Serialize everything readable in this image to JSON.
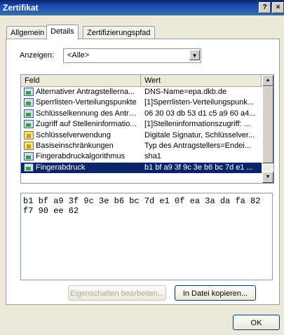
{
  "window": {
    "title": "Zertifikat",
    "help_label": "?",
    "close_label": "×"
  },
  "tabs": [
    {
      "label": "Allgemein"
    },
    {
      "label": "Details"
    },
    {
      "label": "Zertifizierungspfad"
    }
  ],
  "show": {
    "label": "Anzeigen:",
    "selected": "<Alle>"
  },
  "list": {
    "columns": {
      "field": "Feld",
      "value": "Wert"
    },
    "rows": [
      {
        "field": "Alternativer Antragstellerna...",
        "value": "DNS-Name=epa.dkb.de",
        "icon": "certificate-field-icon"
      },
      {
        "field": "Sperrlisten-Verteilungspunkte",
        "value": "[1]Sperrlisten-Verteilungspunk...",
        "icon": "certificate-field-icon"
      },
      {
        "field": "Schlüsselkennung des Antra...",
        "value": "06 30 03 db 53 d1 c5 a9 60 a4...",
        "icon": "certificate-field-icon"
      },
      {
        "field": "Zugriff auf Stelleninformatio...",
        "value": "[1]Stelleninformationszugriff: ...",
        "icon": "certificate-field-icon"
      },
      {
        "field": "Schlüsselverwendung",
        "value": "Digitale Signatur, Schlüsselver...",
        "icon": "critical-extension-icon"
      },
      {
        "field": "Basiseinschränkungen",
        "value": "Typ des Antragstellers=Endei...",
        "icon": "critical-extension-icon"
      },
      {
        "field": "Fingerabdruckalgorithmus",
        "value": "sha1",
        "icon": "property-icon"
      },
      {
        "field": "Fingerabdruck",
        "value": "b1 bf a9 3f 9c 3e b6 bc 7d e1 ...",
        "icon": "property-icon",
        "selected": true
      }
    ]
  },
  "detail": {
    "text": "b1 bf a9 3f 9c 3e b6 bc 7d e1 0f ea 3a da fa 82 f7 90 ee 62"
  },
  "buttons": {
    "edit_properties": "Eigenschaften bearbeiten...",
    "copy_to_file": "In Datei kopieren...",
    "ok": "OK"
  },
  "colors": {
    "title_bar": "#0a246a",
    "selection": "#0a246a",
    "dialog_bg": "#ece9d8"
  }
}
